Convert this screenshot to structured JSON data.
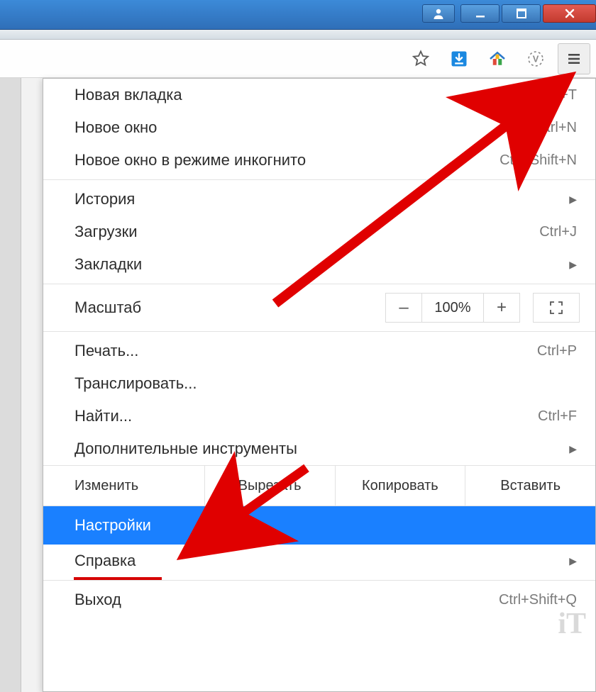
{
  "menu": {
    "new_tab": {
      "label": "Новая вкладка",
      "shortcut": "Ctrl+T"
    },
    "new_window": {
      "label": "Новое окно",
      "shortcut": "Ctrl+N"
    },
    "incognito": {
      "label": "Новое окно в режиме инкогнито",
      "shortcut": "Ctrl+Shift+N"
    },
    "history": {
      "label": "История"
    },
    "downloads": {
      "label": "Загрузки",
      "shortcut": "Ctrl+J"
    },
    "bookmarks": {
      "label": "Закладки"
    },
    "zoom": {
      "label": "Масштаб",
      "value": "100%",
      "minus": "–",
      "plus": "+"
    },
    "print": {
      "label": "Печать...",
      "shortcut": "Ctrl+P"
    },
    "cast": {
      "label": "Транслировать..."
    },
    "find": {
      "label": "Найти...",
      "shortcut": "Ctrl+F"
    },
    "moretools": {
      "label": "Дополнительные инструменты"
    },
    "edit": {
      "label": "Изменить",
      "cut": "Вырезать",
      "copy": "Копировать",
      "paste": "Вставить"
    },
    "settings": {
      "label": "Настройки"
    },
    "help": {
      "label": "Справка"
    },
    "exit": {
      "label": "Выход",
      "shortcut": "Ctrl+Shift+Q"
    }
  },
  "watermark": "iT"
}
